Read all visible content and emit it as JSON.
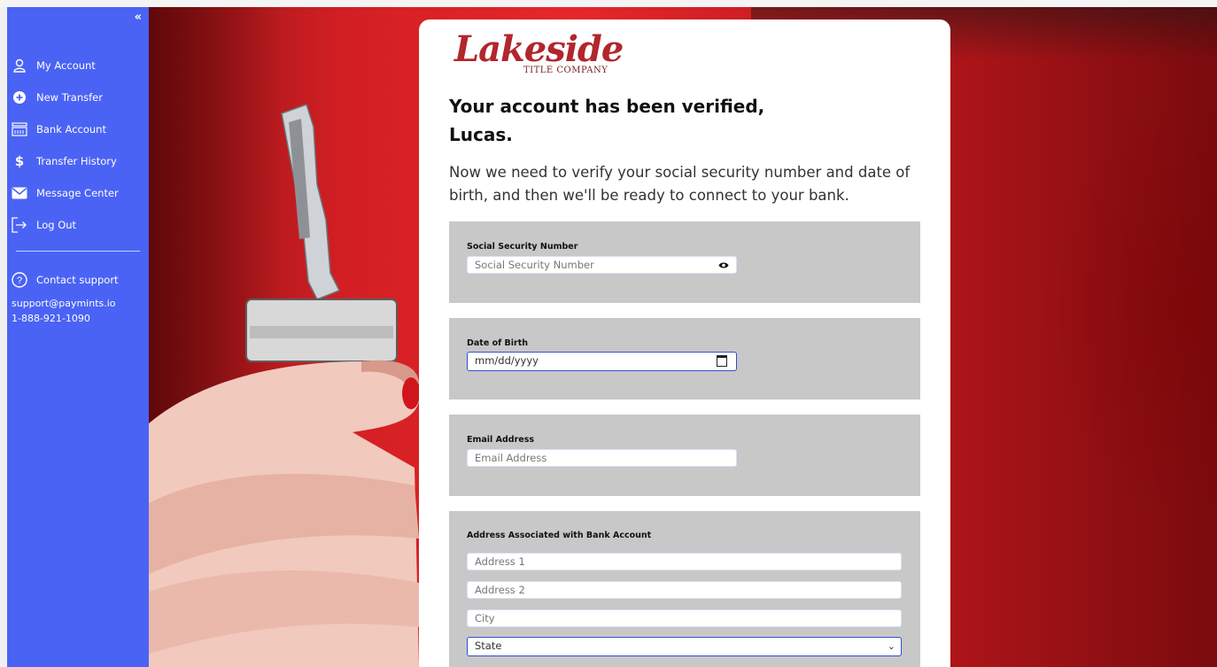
{
  "sidebar": {
    "collapse_label": "«",
    "items": [
      {
        "label": "My Account",
        "icon": "user-icon"
      },
      {
        "label": "New Transfer",
        "icon": "plus-circle-icon"
      },
      {
        "label": "Bank Account",
        "icon": "bank-icon"
      },
      {
        "label": "Transfer History",
        "icon": "dollar-icon"
      },
      {
        "label": "Message Center",
        "icon": "mail-icon"
      },
      {
        "label": "Log Out",
        "icon": "logout-icon"
      }
    ],
    "support": {
      "label": "Contact support",
      "icon": "question-circle-icon",
      "email": "support@paymints.io",
      "phone": "1-888-921-1090"
    }
  },
  "brand": {
    "name": "Lakeside",
    "subtitle": "TITLE COMPANY",
    "color": "#b2262c"
  },
  "main": {
    "heading_line1": "Your account has been verified,",
    "heading_line2": "Lucas.",
    "lead": "Now we need to verify your social security number and date of birth, and then we'll be ready to connect to your bank.",
    "ssn": {
      "label": "Social Security Number",
      "placeholder": "Social Security Number",
      "icon": "eye-icon"
    },
    "dob": {
      "label": "Date of Birth",
      "placeholder": "mm/dd/yyyy",
      "icon": "calendar-icon"
    },
    "email": {
      "label": "Email Address",
      "placeholder": "Email Address"
    },
    "address": {
      "label": "Address Associated with Bank Account",
      "address1": "Address 1",
      "address2": "Address 2",
      "city": "City",
      "state": "State"
    }
  },
  "colors": {
    "sidebar": "#4a63f5",
    "section_bg": "#c8c8c8",
    "focus": "#2f4fd6"
  }
}
